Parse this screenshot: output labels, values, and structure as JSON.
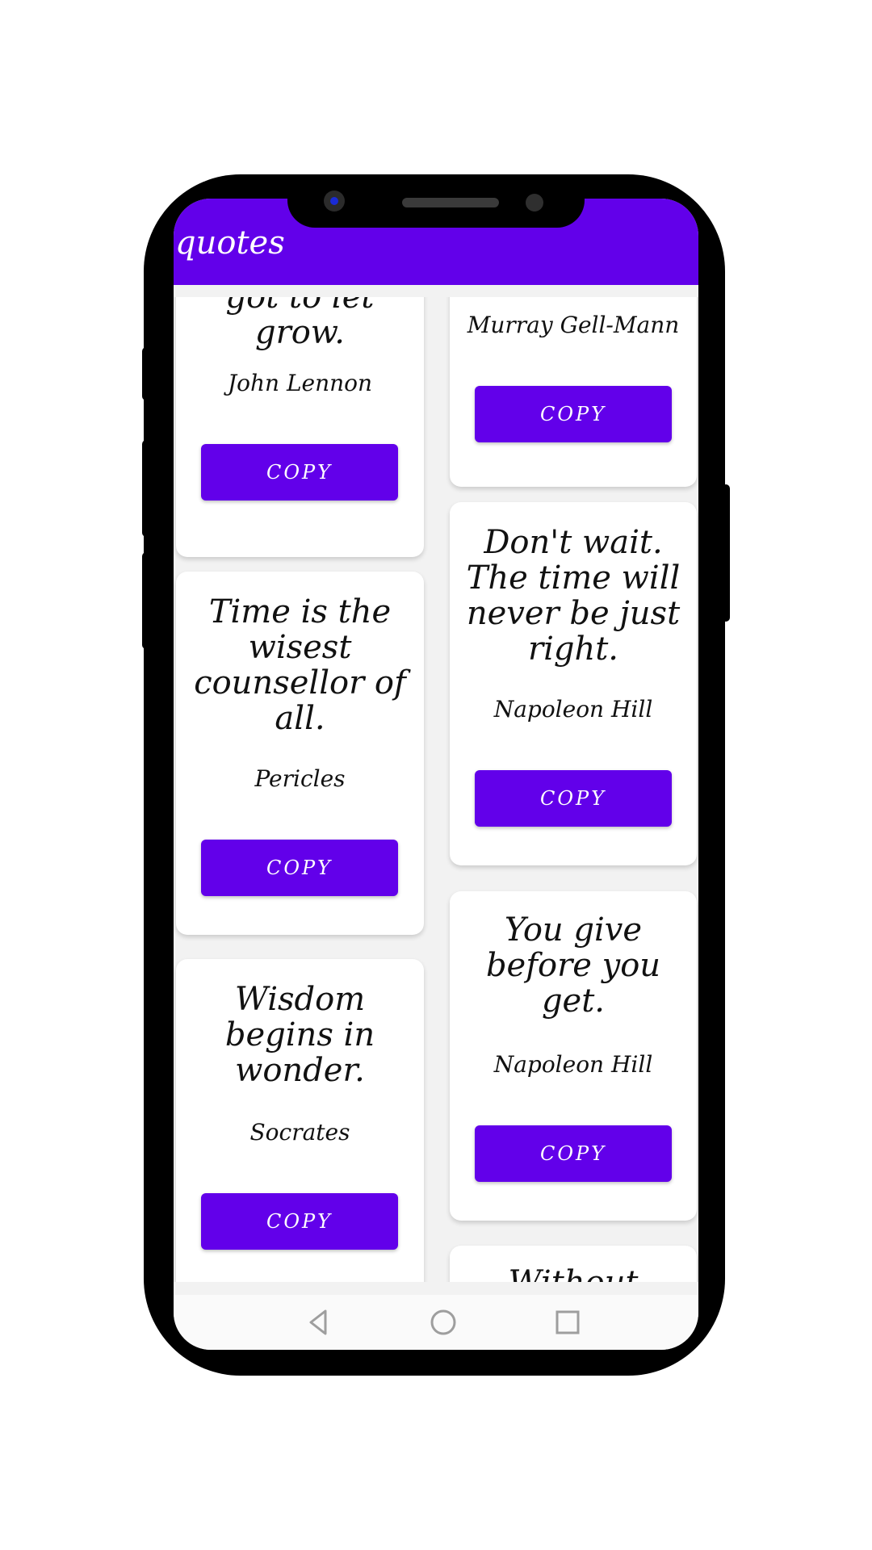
{
  "app": {
    "title": "quotes",
    "accent_color": "#6200ea"
  },
  "quotes": {
    "left": [
      {
        "text": "got to let grow.",
        "author": "John Lennon",
        "button": "COPY"
      },
      {
        "text": "Time is the wisest counsellor of all.",
        "author": "Pericles",
        "button": "COPY"
      },
      {
        "text": "Wisdom begins in wonder.",
        "author": "Socrates",
        "button": "COPY"
      }
    ],
    "right": [
      {
        "text": "",
        "author": "Murray Gell-Mann",
        "button": "COPY"
      },
      {
        "text": "Don't wait. The time will never be just right.",
        "author": "Napoleon Hill",
        "button": "COPY"
      },
      {
        "text": "You give before you get.",
        "author": "Napoleon Hill",
        "button": "COPY"
      },
      {
        "text": "Without",
        "author": "",
        "button": ""
      }
    ]
  },
  "navbar": {
    "icons": [
      "back-icon",
      "home-icon",
      "recents-icon"
    ]
  }
}
